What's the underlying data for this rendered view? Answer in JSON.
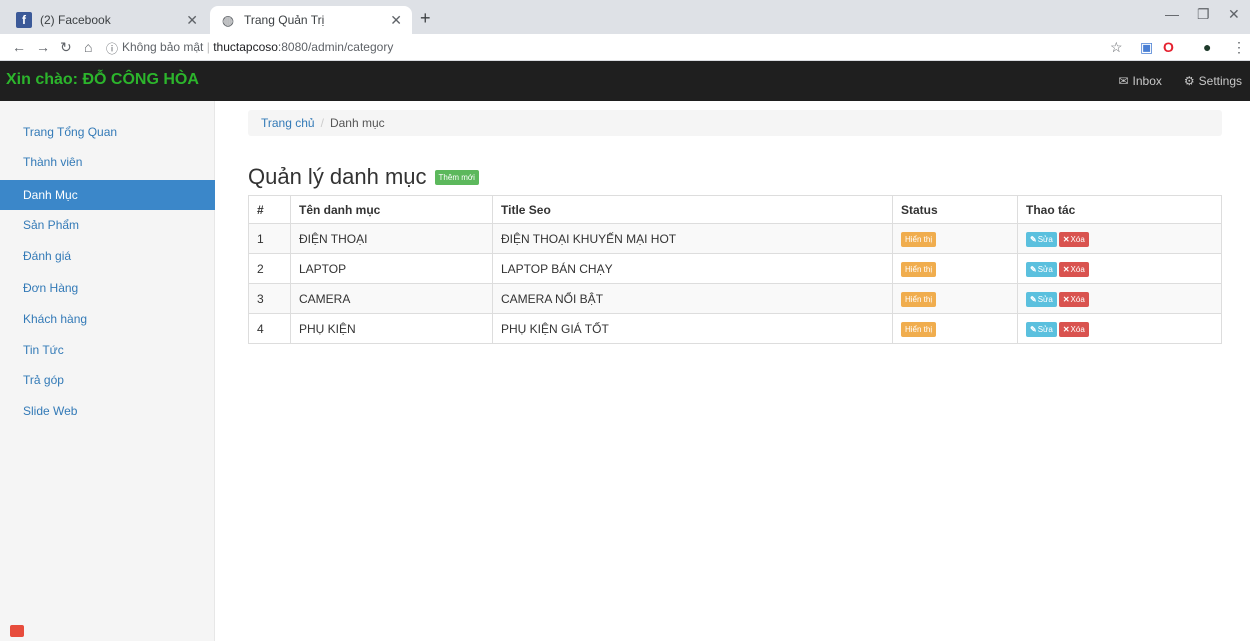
{
  "browser": {
    "tabs": [
      {
        "title": "(2) Facebook",
        "icon": "facebook-icon"
      },
      {
        "title": "Trang Quản Trị",
        "icon": "globe-icon"
      }
    ],
    "security_label": "Không bảo mật",
    "url_host": "thuctapcoso",
    "url_rest": ":8080/admin/category"
  },
  "header": {
    "greeting": "Xin chào: ĐỖ CÔNG HÒA",
    "inbox_label": "Inbox",
    "settings_label": "Settings"
  },
  "sidebar": {
    "items": [
      {
        "label": "Trang Tổng Quan"
      },
      {
        "label": "Thành viên"
      },
      {
        "label": "Danh Mục"
      },
      {
        "label": "Sản Phẩm"
      },
      {
        "label": "Đánh giá"
      },
      {
        "label": "Đơn Hàng"
      },
      {
        "label": "Khách hàng"
      },
      {
        "label": "Tin Tức"
      },
      {
        "label": "Trả góp"
      },
      {
        "label": "Slide Web"
      }
    ],
    "active_index": 2
  },
  "breadcrumb": {
    "home": "Trang chủ",
    "separator": "/",
    "current": "Danh mục"
  },
  "main": {
    "title": "Quản lý danh mục",
    "add_button": "Thêm mới",
    "table": {
      "headers": [
        "#",
        "Tên danh mục",
        "Title Seo",
        "Status",
        "Thao tác"
      ],
      "rows": [
        {
          "num": "1",
          "name": "ĐIỆN THOẠI",
          "seo": "ĐIỆN THOẠI KHUYẾN MẠI HOT",
          "status": "Hiển thị",
          "edit": "Sửa",
          "delete": "Xóa"
        },
        {
          "num": "2",
          "name": "LAPTOP",
          "seo": "LAPTOP BÁN CHẠY",
          "status": "Hiển thị",
          "edit": "Sửa",
          "delete": "Xóa"
        },
        {
          "num": "3",
          "name": "CAMERA",
          "seo": "CAMERA NỔI BẬT",
          "status": "Hiển thị",
          "edit": "Sửa",
          "delete": "Xóa"
        },
        {
          "num": "4",
          "name": "PHỤ KIỆN",
          "seo": "PHỤ KIỆN GIÁ TỐT",
          "status": "Hiển thị",
          "edit": "Sửa",
          "delete": "Xóa"
        }
      ]
    }
  },
  "colors": {
    "brand_green": "#2cb52c",
    "sidebar_active": "#3b87c9",
    "status_orange": "#f0ad4e",
    "edit_blue": "#5bc0de",
    "delete_red": "#d9534f",
    "add_green": "#5cb85c"
  }
}
